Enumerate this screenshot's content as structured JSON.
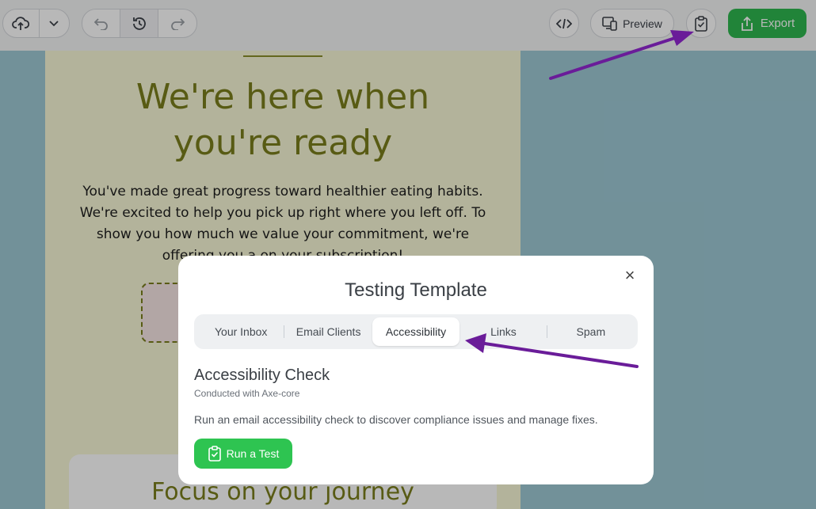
{
  "toolbar": {
    "preview_label": "Preview",
    "export_label": "Export",
    "icons": [
      "cloud-upload-icon",
      "chevron-down-icon",
      "undo-icon",
      "history-icon",
      "redo-icon",
      "code-icon",
      "devices-icon",
      "clipboard-check-icon",
      "share-icon"
    ]
  },
  "email": {
    "hero_title_line1": "We're here when",
    "hero_title_line2": "you're ready",
    "hero_text": "You've made great progress toward healthier eating habits. We're excited to help you pick up right where you left off. To show you how much we value your commitment, we're offering you a on your subscription!",
    "journey_title": "Focus on your journey"
  },
  "modal": {
    "title": "Testing Template",
    "tabs": [
      "Your Inbox",
      "Email Clients",
      "Accessibility",
      "Links",
      "Spam"
    ],
    "active_tab": "Accessibility",
    "section_title": "Accessibility Check",
    "section_subtitle": "Conducted with Axe-core",
    "section_description": "Run an email accessibility check to discover compliance issues and manage fixes.",
    "run_button_label": "Run a Test"
  },
  "colors": {
    "accent_green": "#2eb84f",
    "arrow_purple": "#6a1c99",
    "title_olive": "#7a7e1c"
  }
}
